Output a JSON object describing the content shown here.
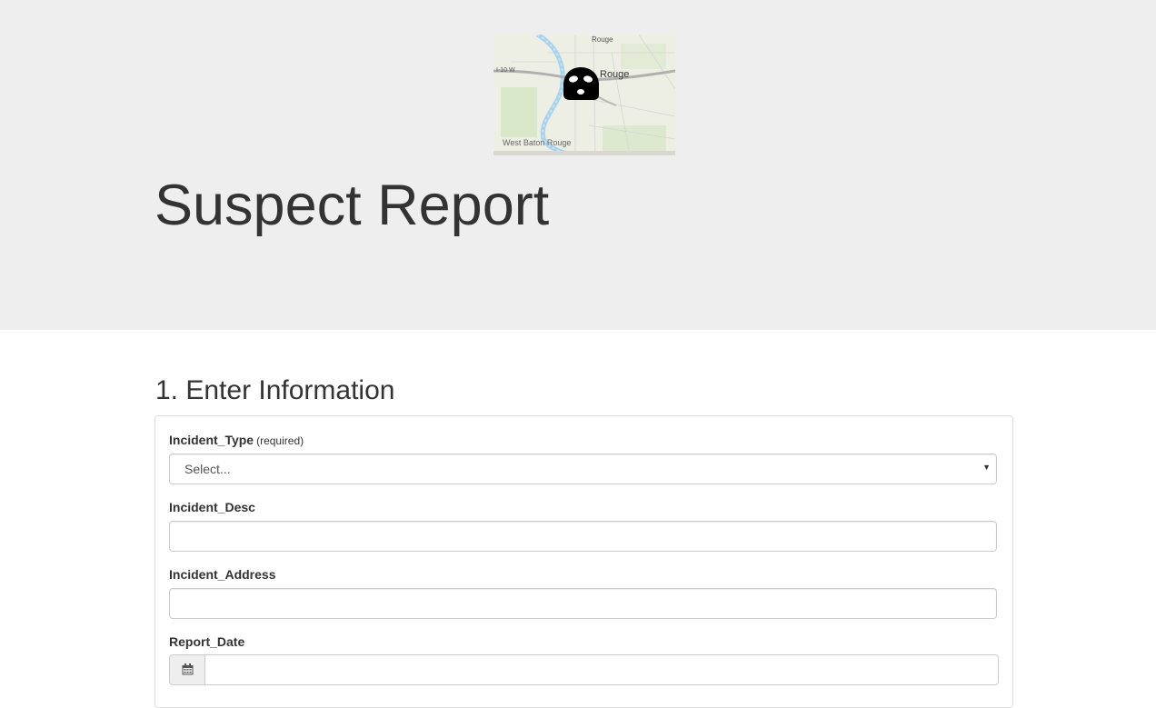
{
  "header": {
    "title": "Suspect Report",
    "logo": {
      "icon": "masked-suspect-icon",
      "map_labels": {
        "city": "Rouge",
        "west_city": "West Baton Rouge",
        "highway": "I-10 W",
        "road": "Rouge"
      }
    }
  },
  "section": {
    "heading": "1. Enter Information"
  },
  "form": {
    "incident_type": {
      "label": "Incident_Type",
      "hint": "(required)",
      "value": "Select..."
    },
    "incident_desc": {
      "label": "Incident_Desc",
      "value": ""
    },
    "incident_address": {
      "label": "Incident_Address",
      "value": ""
    },
    "report_date": {
      "label": "Report_Date",
      "icon": "calendar-icon",
      "value": ""
    }
  },
  "colors": {
    "jumbotron_bg": "#eeeeee",
    "text": "#333333",
    "border": "#cccccc"
  }
}
